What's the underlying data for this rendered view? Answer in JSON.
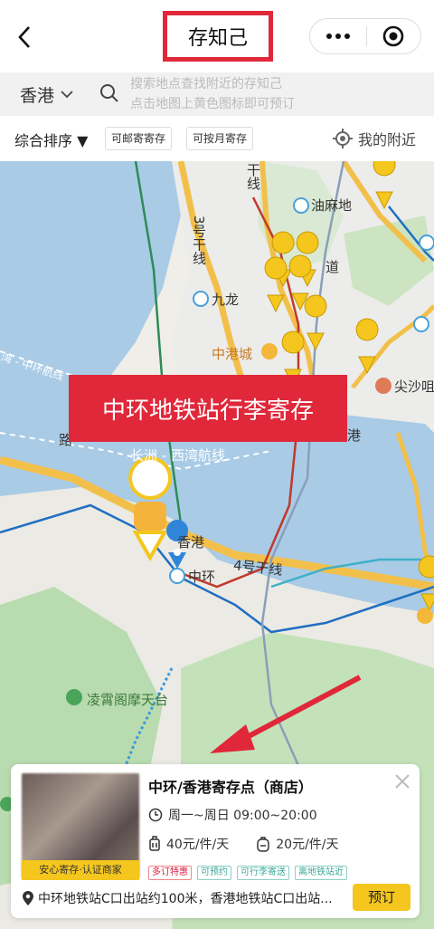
{
  "header": {
    "title": "存知己"
  },
  "search": {
    "city": "香港",
    "placeholder_line1": "搜索地点查找附近的存知己",
    "placeholder_line2": "点击地图上黄色图标即可预订"
  },
  "filters": {
    "sort": "综合排序",
    "chips": [
      "可邮寄寄存",
      "可按月寄存"
    ],
    "nearby": "我的附近"
  },
  "map": {
    "labels": {
      "youmadi": "油麻地",
      "jiulong": "九龙",
      "zhonggangcheng": "中港城",
      "jianshazui": "尖沙咀",
      "xianggang": "香港",
      "zhonghuan": "中环",
      "hao4": "4号干线",
      "hao3": "3号干线",
      "changzhou": "长洲 - 西湾航线",
      "zhonghuanhang": "湾 - 中环航线",
      "lingxiao": "凌霄阁摩天台",
      "gan": "干线",
      "gang": "港",
      "daodao": "道",
      "lu": "路"
    },
    "banner": "中环地铁站行李寄存"
  },
  "card": {
    "title": "中环/香港寄存点（商店）",
    "hours": "周一~周日 09:00~20:00",
    "price_large": "40元/件/天",
    "price_small": "20元/件/天",
    "thumb_caption": "安心寄存·认证商家",
    "tags": [
      "多订特惠",
      "可预约",
      "可行李寄送",
      "离地铁站近"
    ],
    "address": "中环地铁站C口出站约100米，香港地铁站C口出站...",
    "book_label": "预订"
  },
  "colors": {
    "accent_red": "#e0283a",
    "brand_yellow": "#f4c61e",
    "water": "#a9cbe6"
  }
}
